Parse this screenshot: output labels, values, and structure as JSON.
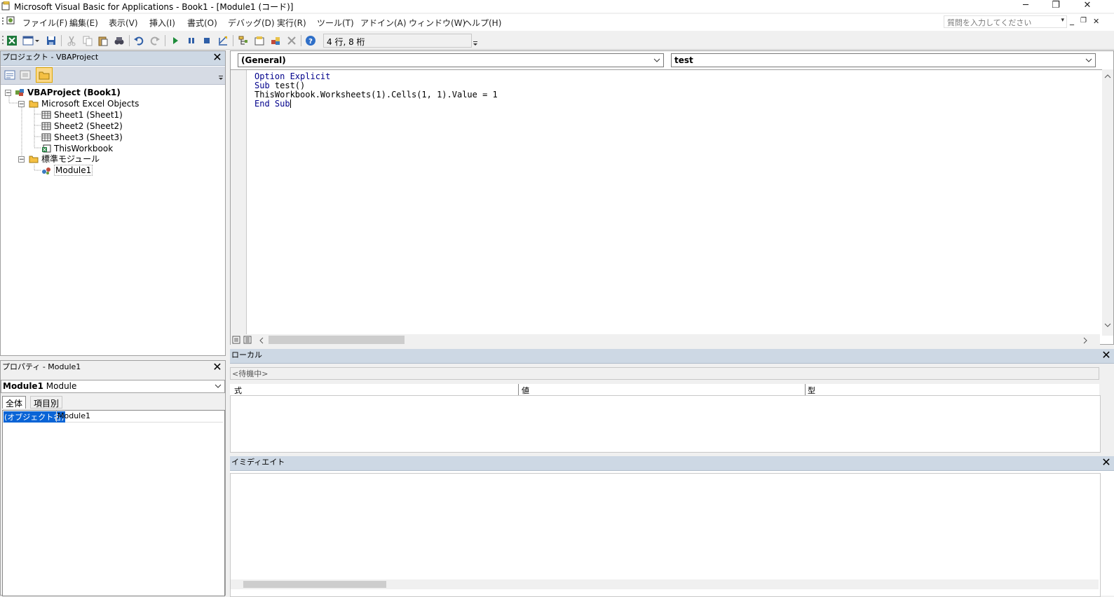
{
  "window": {
    "title": "Microsoft Visual Basic for Applications - Book1 - [Module1 (コード)]",
    "minimize": "─",
    "restore": "❐",
    "close": "✕"
  },
  "menu": {
    "items": [
      "ファイル(F)",
      "編集(E)",
      "表示(V)",
      "挿入(I)",
      "書式(O)",
      "デバッグ(D)",
      "実行(R)",
      "ツール(T)",
      "アドイン(A)",
      "ウィンドウ(W)",
      "ヘルプ(H)"
    ],
    "help_placeholder": "質問を入力してください",
    "help_dropdown": "▾",
    "mdi_min": "_",
    "mdi_restore": "❐",
    "mdi_close": "✕"
  },
  "toolbar": {
    "position": "4 行, 8 桁"
  },
  "project_pane": {
    "title": "プロジェクト - VBAProject",
    "close": "✕",
    "tree": {
      "root": "VBAProject (Book1)",
      "folder_objects": "Microsoft Excel Objects",
      "sheet1": "Sheet1 (Sheet1)",
      "sheet2": "Sheet2 (Sheet2)",
      "sheet3": "Sheet3 (Sheet3)",
      "workbook": "ThisWorkbook",
      "folder_modules": "標準モジュール",
      "module1": "Module1"
    }
  },
  "properties_pane": {
    "title": "プロパティ - Module1",
    "close": "✕",
    "object_name": "Module1",
    "object_type": "Module",
    "tab_all": "全体",
    "tab_category": "項目別",
    "prop_name": "(オブジェクト名)",
    "prop_value": "Module1"
  },
  "code_window": {
    "object_combo": "(General)",
    "proc_combo": "test",
    "lines": {
      "l1_kw": "Option Explicit",
      "l2_kw": "Sub",
      "l2_rest": " test()",
      "l3": "ThisWorkbook.Worksheets(1).Cells(1, 1).Value = 1",
      "l4_kw": "End Sub"
    }
  },
  "locals_pane": {
    "title": "ローカル",
    "close": "✕",
    "status": "<待機中>",
    "col_expr": "式",
    "col_value": "値",
    "col_type": "型"
  },
  "immediate_pane": {
    "title": "イミディエイト",
    "close": "✕"
  }
}
